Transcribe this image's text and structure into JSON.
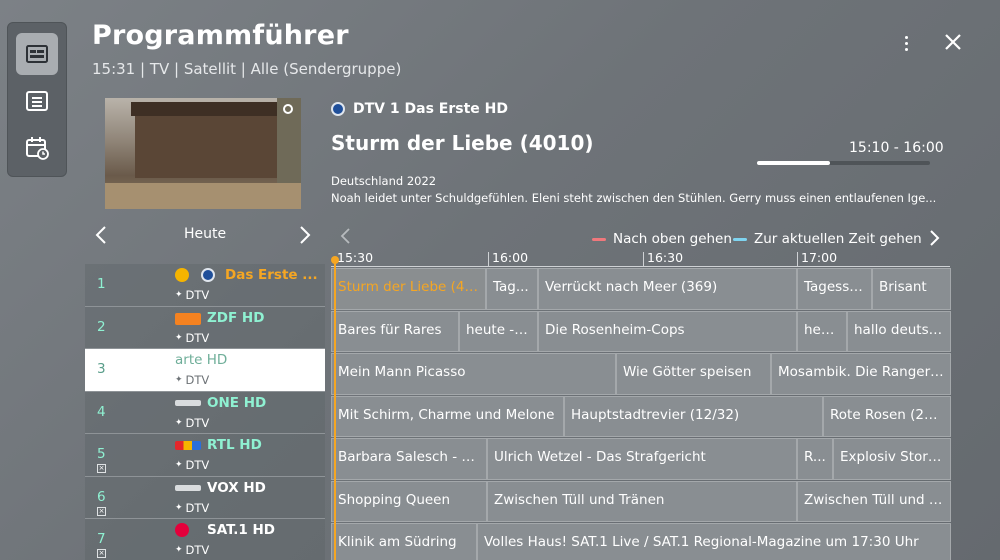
{
  "header": {
    "title": "Programmführer",
    "subtitle": "15:31 | TV | Satellit | Alle (Sendergruppe)"
  },
  "side_rail": {
    "items": [
      "guide-icon",
      "list-icon",
      "schedule-icon"
    ],
    "active": 0
  },
  "preview_program": {
    "channel": "DTV  1 Das Erste HD",
    "title": "Sturm der Liebe (4010)",
    "time": "15:10 - 16:00",
    "progress": 0.42,
    "origin": "Deutschland 2022",
    "description": "Noah leidet unter Schuldgefühlen. Eleni steht zwischen den Stühlen. Gerry muss einen entlaufenen Ige..."
  },
  "day_nav": {
    "label": "Heute"
  },
  "legend": {
    "red": "Nach oben gehen",
    "blue": "Zur aktuellen Zeit gehen",
    "red_color": "#f0787c",
    "blue_color": "#7fd4f0"
  },
  "timeline": {
    "labels": [
      "15:30",
      "16:00",
      "16:30",
      "17:00"
    ]
  },
  "channels": [
    {
      "number": "1",
      "name": "Das Erste ...",
      "tag": "DTV",
      "color": "orange",
      "selected": false,
      "box": false
    },
    {
      "number": "2",
      "name": "ZDF HD",
      "tag": "DTV",
      "color": "teal",
      "selected": false,
      "box": false
    },
    {
      "number": "3",
      "name": "arte HD",
      "tag": "DTV",
      "color": "teal",
      "selected": true,
      "box": false
    },
    {
      "number": "4",
      "name": "ONE HD",
      "tag": "DTV",
      "color": "teal",
      "selected": false,
      "box": false
    },
    {
      "number": "5",
      "name": "RTL HD",
      "tag": "DTV",
      "color": "teal",
      "selected": false,
      "box": true
    },
    {
      "number": "6",
      "name": "VOX HD",
      "tag": "DTV",
      "color": "white",
      "selected": false,
      "box": true
    },
    {
      "number": "7",
      "name": "SAT.1 HD",
      "tag": "DTV",
      "color": "white",
      "selected": false,
      "box": true
    }
  ],
  "schedule": [
    [
      "Sturm der Liebe (40...",
      "Tag...",
      "Verrückt nach Meer (369)",
      "Tagessc...",
      "Brisant"
    ],
    [
      "Bares für Rares",
      "heute - i...",
      "Die Rosenheim-Cops",
      "heute",
      "hallo deutsc..."
    ],
    [
      "Mein Mann Picasso",
      "Wie Götter speisen",
      "Mosambik. Die Ranger v..."
    ],
    [
      "Mit Schirm, Charme und Melone",
      "Hauptstadtrevier (12/32)",
      "Rote Rosen (209)"
    ],
    [
      "Barbara Salesch - Da...",
      "Ulrich Wetzel - Das Strafgericht",
      "R...",
      "Explosiv Stories"
    ],
    [
      "Shopping Queen",
      "Zwischen Tüll und Tränen",
      "Zwischen Tüll und Tr..."
    ],
    [
      "Klinik am Südring",
      "Volles Haus! SAT.1 Live / SAT.1 Regional-Magazine um 17:30 Uhr"
    ]
  ]
}
